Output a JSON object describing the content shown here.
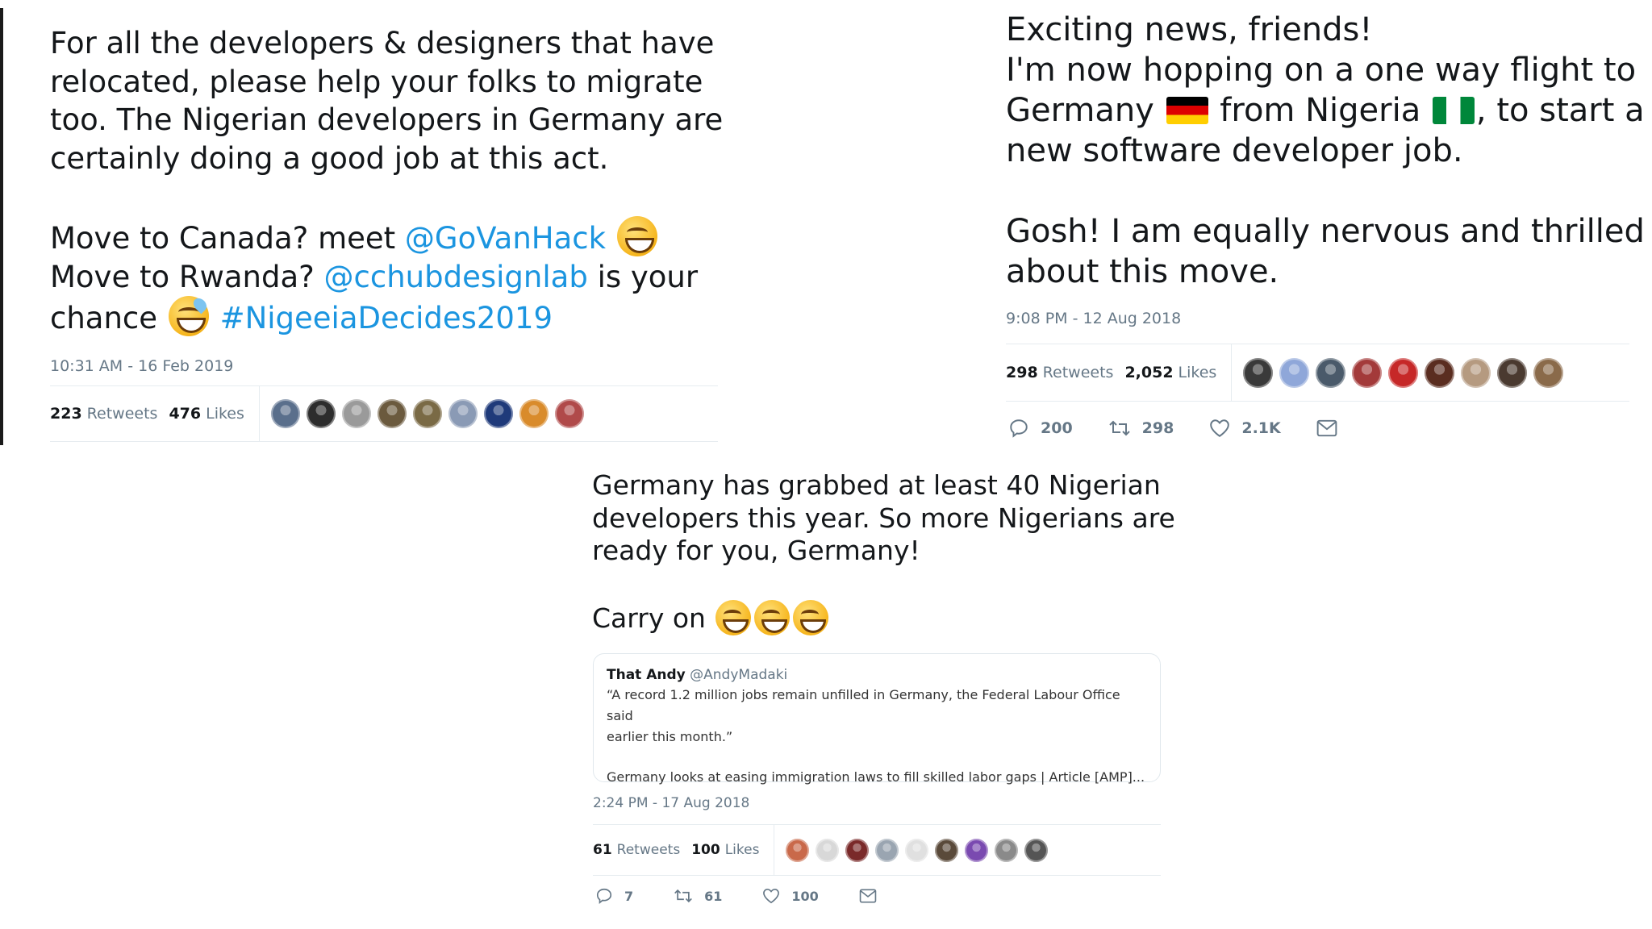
{
  "tweet_left": {
    "lines": [
      "For all the developers & designers that have",
      "relocated, please help your folks to migrate",
      "too. The Nigerian developers in Germany are",
      "certainly doing a good job at this act."
    ],
    "canada_prefix": "Move to Canada? meet",
    "canada_link": "@GoVanHack",
    "rwanda_prefix": "Move to Rwanda?",
    "rwanda_link": "@cchubdesignlab",
    "rwanda_suffix": "is your",
    "chance_word": "chance",
    "hashtag": "#NigeeiaDecides2019",
    "timestamp": "10:31 AM - 16 Feb 2019",
    "retweets_count": "223",
    "retweets_label": "Retweets",
    "likes_count": "476",
    "likes_label": "Likes",
    "avatar_colors": [
      "#5a6f8c",
      "#2d2d2d",
      "#9a9a9a",
      "#6b5a3e",
      "#7a6a45",
      "#8a9ab5",
      "#1f3a7a",
      "#d98b2b",
      "#b04a4a"
    ]
  },
  "tweet_right": {
    "line1": "Exciting news, friends!",
    "line2": "I'm now hopping on a one way flight to",
    "line3_a": "Germany",
    "line3_b": "from Nigeria",
    "line3_c": ", to start a",
    "line4": "new software developer job.",
    "line5": "Gosh! I am equally nervous and thrilled",
    "line6": "about this move.",
    "timestamp": "9:08 PM - 12 Aug 2018",
    "retweets_count": "298",
    "retweets_label": "Retweets",
    "likes_count": "2,052",
    "likes_label": "Likes",
    "avatar_colors": [
      "#3a3a3a",
      "#8fa7d9",
      "#4a5a6a",
      "#a33a3a",
      "#c62828",
      "#5a2d20",
      "#b59a80",
      "#4a3a30",
      "#8a6a4a"
    ],
    "replies": "200",
    "retweets_action": "298",
    "likes_action": "2.1K"
  },
  "tweet_bottom": {
    "line1": "Germany has grabbed at least 40 Nigerian",
    "line2": "developers this year. So more Nigerians are",
    "line3": "ready for you, Germany!",
    "line4": "Carry on",
    "quote_name": "That Andy",
    "quote_handle": "@AndyMadaki",
    "quote_line1": "“A record 1.2 million jobs remain unfilled in Germany, the Federal Labour Office said",
    "quote_line2": "earlier this month.”",
    "quote_line3": "Germany looks at easing immigration laws to fill skilled labor gaps | Article [AMP]...",
    "timestamp": "2:24 PM - 17 Aug 2018",
    "retweets_count": "61",
    "retweets_label": "Retweets",
    "likes_count": "100",
    "likes_label": "Likes",
    "avatar_colors": [
      "#c9694a",
      "#d8d8d8",
      "#7a2a2a",
      "#9aa5b1",
      "#e0e0e0",
      "#5a4a3a",
      "#7a4ab0",
      "#8a8a8a",
      "#555555"
    ],
    "replies": "7",
    "retweets_action": "61",
    "likes_action": "100"
  }
}
